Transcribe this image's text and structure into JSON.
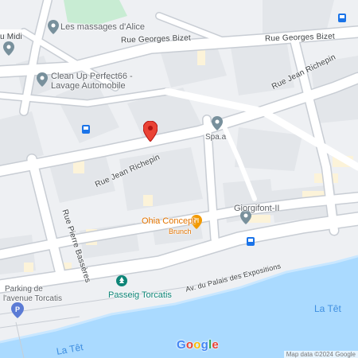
{
  "streets": {
    "georges_bizet_left": "Rue Georges Bizet",
    "georges_bizet_right": "Rue Georges Bizet",
    "jean_richepin_upper": "Rue Jean Richepin",
    "jean_richepin_lower": "Rue Jean Richepin",
    "pierre_basseres": "Rue Pierre Bassères",
    "palais_expositions": "Av. du Palais des Expositions",
    "midi": "u Midi"
  },
  "places": {
    "massages": "Les massages d'Alice",
    "cleanup_line1": "Clean Up Perfect66 -",
    "cleanup_line2": "Lavage Automobile",
    "spa": "Spa.a",
    "ohia_name": "Ohia Concept",
    "ohia_sub": "Brunch",
    "giorgifont": "Giorgifont-II",
    "passeig": "Passeig Torcatis",
    "parking_line1": "Parking de",
    "parking_line2": "l'avenue Torcatis"
  },
  "water": {
    "tet_right": "La Têt",
    "tet_left": "La Têt"
  },
  "branding": {
    "google": "Google",
    "google_letters": [
      "G",
      "o",
      "o",
      "g",
      "l",
      "e"
    ],
    "attribution": "Map data ©2024 Google"
  },
  "colors": {
    "background": "#eef0f3",
    "road": "#ffffff",
    "road_edge": "#c8cdd4",
    "building": "#e3e6ea",
    "highlight": "#fcf3d9",
    "green": "#c8ecd3",
    "river": "#aadaff",
    "pin_red": "#ea4335",
    "transit": "#1a73e8",
    "parking": "#5b7bd5",
    "google_blue": "#4285f4",
    "google_red": "#ea4335",
    "google_yellow": "#fbbc05",
    "google_green": "#34a853"
  },
  "icons": {
    "selected_place": "red-pin-icon",
    "poi": "gray-pin-icon",
    "food": "fork-knife-icon",
    "park": "park-icon",
    "parking": "parking-icon",
    "bus": "bus-stop-icon"
  }
}
